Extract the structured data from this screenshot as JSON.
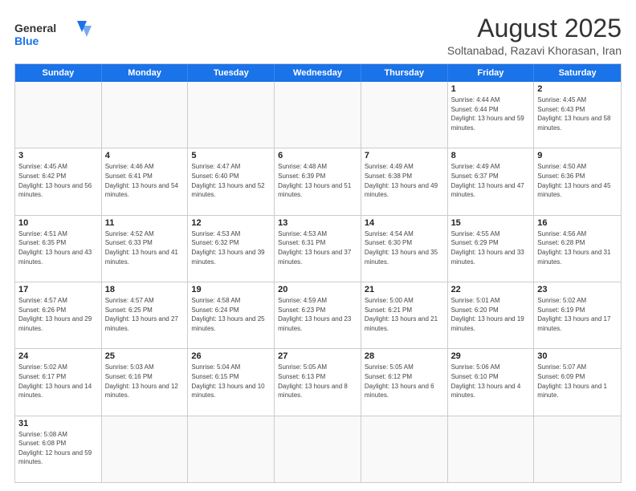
{
  "header": {
    "logo_general": "General",
    "logo_blue": "Blue",
    "month_title": "August 2025",
    "location": "Soltanabad, Razavi Khorasan, Iran"
  },
  "weekdays": [
    "Sunday",
    "Monday",
    "Tuesday",
    "Wednesday",
    "Thursday",
    "Friday",
    "Saturday"
  ],
  "rows": [
    [
      {
        "day": "",
        "empty": true
      },
      {
        "day": "",
        "empty": true
      },
      {
        "day": "",
        "empty": true
      },
      {
        "day": "",
        "empty": true
      },
      {
        "day": "",
        "empty": true
      },
      {
        "day": "1",
        "sunrise": "4:44 AM",
        "sunset": "6:44 PM",
        "daylight": "13 hours and 59 minutes."
      },
      {
        "day": "2",
        "sunrise": "4:45 AM",
        "sunset": "6:43 PM",
        "daylight": "13 hours and 58 minutes."
      }
    ],
    [
      {
        "day": "3",
        "sunrise": "4:45 AM",
        "sunset": "6:42 PM",
        "daylight": "13 hours and 56 minutes."
      },
      {
        "day": "4",
        "sunrise": "4:46 AM",
        "sunset": "6:41 PM",
        "daylight": "13 hours and 54 minutes."
      },
      {
        "day": "5",
        "sunrise": "4:47 AM",
        "sunset": "6:40 PM",
        "daylight": "13 hours and 52 minutes."
      },
      {
        "day": "6",
        "sunrise": "4:48 AM",
        "sunset": "6:39 PM",
        "daylight": "13 hours and 51 minutes."
      },
      {
        "day": "7",
        "sunrise": "4:49 AM",
        "sunset": "6:38 PM",
        "daylight": "13 hours and 49 minutes."
      },
      {
        "day": "8",
        "sunrise": "4:49 AM",
        "sunset": "6:37 PM",
        "daylight": "13 hours and 47 minutes."
      },
      {
        "day": "9",
        "sunrise": "4:50 AM",
        "sunset": "6:36 PM",
        "daylight": "13 hours and 45 minutes."
      }
    ],
    [
      {
        "day": "10",
        "sunrise": "4:51 AM",
        "sunset": "6:35 PM",
        "daylight": "13 hours and 43 minutes."
      },
      {
        "day": "11",
        "sunrise": "4:52 AM",
        "sunset": "6:33 PM",
        "daylight": "13 hours and 41 minutes."
      },
      {
        "day": "12",
        "sunrise": "4:53 AM",
        "sunset": "6:32 PM",
        "daylight": "13 hours and 39 minutes."
      },
      {
        "day": "13",
        "sunrise": "4:53 AM",
        "sunset": "6:31 PM",
        "daylight": "13 hours and 37 minutes."
      },
      {
        "day": "14",
        "sunrise": "4:54 AM",
        "sunset": "6:30 PM",
        "daylight": "13 hours and 35 minutes."
      },
      {
        "day": "15",
        "sunrise": "4:55 AM",
        "sunset": "6:29 PM",
        "daylight": "13 hours and 33 minutes."
      },
      {
        "day": "16",
        "sunrise": "4:56 AM",
        "sunset": "6:28 PM",
        "daylight": "13 hours and 31 minutes."
      }
    ],
    [
      {
        "day": "17",
        "sunrise": "4:57 AM",
        "sunset": "6:26 PM",
        "daylight": "13 hours and 29 minutes."
      },
      {
        "day": "18",
        "sunrise": "4:57 AM",
        "sunset": "6:25 PM",
        "daylight": "13 hours and 27 minutes."
      },
      {
        "day": "19",
        "sunrise": "4:58 AM",
        "sunset": "6:24 PM",
        "daylight": "13 hours and 25 minutes."
      },
      {
        "day": "20",
        "sunrise": "4:59 AM",
        "sunset": "6:23 PM",
        "daylight": "13 hours and 23 minutes."
      },
      {
        "day": "21",
        "sunrise": "5:00 AM",
        "sunset": "6:21 PM",
        "daylight": "13 hours and 21 minutes."
      },
      {
        "day": "22",
        "sunrise": "5:01 AM",
        "sunset": "6:20 PM",
        "daylight": "13 hours and 19 minutes."
      },
      {
        "day": "23",
        "sunrise": "5:02 AM",
        "sunset": "6:19 PM",
        "daylight": "13 hours and 17 minutes."
      }
    ],
    [
      {
        "day": "24",
        "sunrise": "5:02 AM",
        "sunset": "6:17 PM",
        "daylight": "13 hours and 14 minutes."
      },
      {
        "day": "25",
        "sunrise": "5:03 AM",
        "sunset": "6:16 PM",
        "daylight": "13 hours and 12 minutes."
      },
      {
        "day": "26",
        "sunrise": "5:04 AM",
        "sunset": "6:15 PM",
        "daylight": "13 hours and 10 minutes."
      },
      {
        "day": "27",
        "sunrise": "5:05 AM",
        "sunset": "6:13 PM",
        "daylight": "13 hours and 8 minutes."
      },
      {
        "day": "28",
        "sunrise": "5:05 AM",
        "sunset": "6:12 PM",
        "daylight": "13 hours and 6 minutes."
      },
      {
        "day": "29",
        "sunrise": "5:06 AM",
        "sunset": "6:10 PM",
        "daylight": "13 hours and 4 minutes."
      },
      {
        "day": "30",
        "sunrise": "5:07 AM",
        "sunset": "6:09 PM",
        "daylight": "13 hours and 1 minute."
      }
    ],
    [
      {
        "day": "31",
        "sunrise": "5:08 AM",
        "sunset": "6:08 PM",
        "daylight": "12 hours and 59 minutes."
      },
      {
        "day": "",
        "empty": true
      },
      {
        "day": "",
        "empty": true
      },
      {
        "day": "",
        "empty": true
      },
      {
        "day": "",
        "empty": true
      },
      {
        "day": "",
        "empty": true
      },
      {
        "day": "",
        "empty": true
      }
    ]
  ]
}
